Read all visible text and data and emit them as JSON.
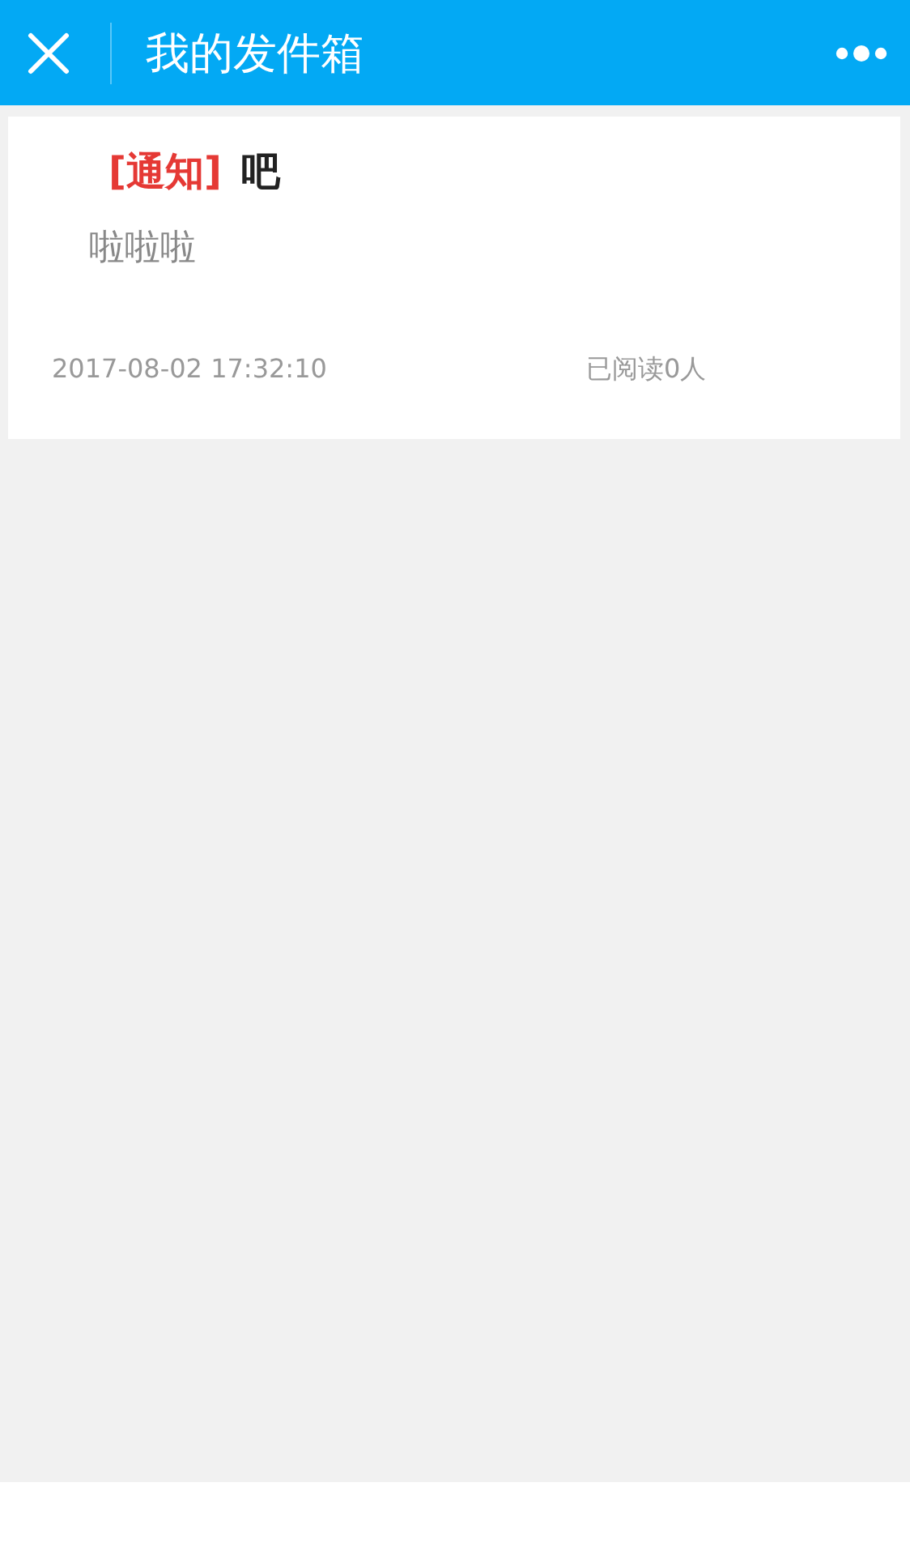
{
  "nav_bar": {
    "title": "我的发件箱"
  },
  "messages": [
    {
      "tag": "[通知]",
      "title": "吧",
      "body": "啦啦啦",
      "time": "2017-08-02 17:32:10",
      "reads": "已阅读0人"
    }
  ]
}
